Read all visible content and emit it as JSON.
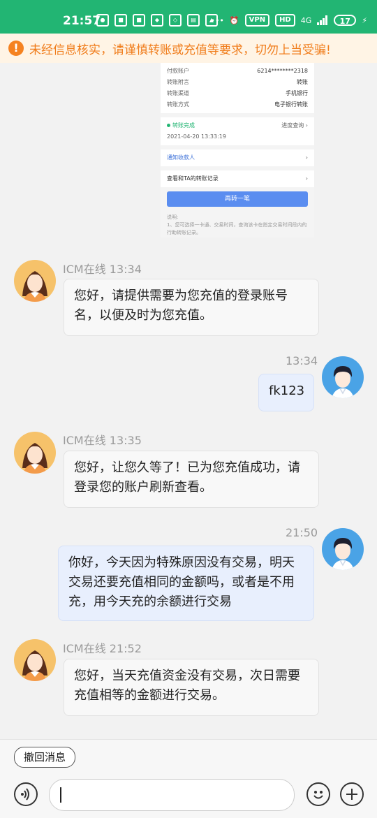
{
  "status_bar": {
    "time": "21:57",
    "vpn_label": "VPN",
    "hd_label": "HD",
    "network_label": "4G",
    "battery_level": "17"
  },
  "warning_banner": {
    "icon": "!",
    "text": "未经信息核实，请谨慎转账或充值等要求，切勿上当受骗!"
  },
  "receipt_image": {
    "rows": [
      {
        "label": "付款账户",
        "value": "6214********2318"
      },
      {
        "label": "转账附言",
        "value": "转账"
      },
      {
        "label": "转账渠道",
        "value": "手机银行"
      },
      {
        "label": "转账方式",
        "value": "电子银行转账"
      }
    ],
    "status": "转账完成",
    "status_time": "2021-04-20 13:33:19",
    "progress_link": "进度查询",
    "notify_payee": "通知收款人",
    "records_link": "查看和TA的转账记录",
    "again_button": "再转一笔",
    "note_title": "说明:",
    "note_text": "1、您可选择一卡通、交易时间，查询该卡在指定交易时间段内的行助转账记录。"
  },
  "messages": [
    {
      "sender": "ICM在线",
      "time": "13:34",
      "text": "您好，请提供需要为您充值的登录账号名，以便及时为您充值。"
    },
    {
      "time": "13:34",
      "text": "fk123"
    },
    {
      "sender": "ICM在线",
      "time": "13:35",
      "text": "您好，让您久等了！已为您充值成功，请登录您的账户刷新查看。"
    },
    {
      "time": "21:50",
      "text": "你好，今天因为特殊原因没有交易，明天交易还要充值相同的金额吗，或者是不用充，用今天充的余额进行交易"
    },
    {
      "sender": "ICM在线",
      "time": "21:52",
      "text": "您好，当天充值资金没有交易，次日需要充值相等的金额进行交易。"
    }
  ],
  "bottom_bar": {
    "recall_label": "撤回消息"
  },
  "colors": {
    "status_bar": "#22b573",
    "warning_text": "#f07c1a",
    "outgoing_bubble": "#e8effd"
  }
}
